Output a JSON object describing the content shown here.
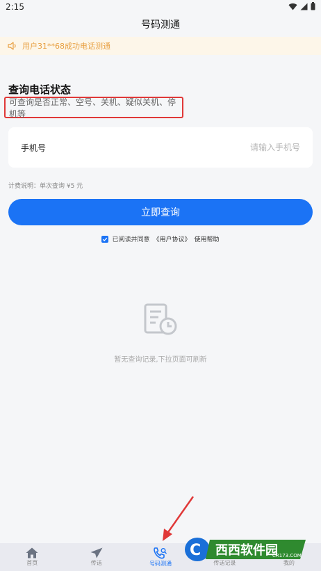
{
  "status_bar": {
    "time": "2:15"
  },
  "header": {
    "title": "号码测通"
  },
  "notice": {
    "text": "用户31**68成功电话测通"
  },
  "query": {
    "title": "查询电话状态",
    "subtitle": "可查询是否正常、空号、关机、疑似关机、停机等",
    "phone_label": "手机号",
    "phone_value": "",
    "phone_placeholder": "请输入手机号",
    "fee_note": "计费说明：单次查询 ¥5 元",
    "submit_label": "立即查询",
    "agree_text": "已阅读并同意",
    "agreement_link": "《用户协议》",
    "help_link": "使用帮助"
  },
  "empty_state": {
    "text": "暂无查询记录,下拉页面可刷新"
  },
  "tabs": [
    {
      "label": "首页",
      "icon": "home-icon",
      "active": false
    },
    {
      "label": "传话",
      "icon": "send-icon",
      "active": false
    },
    {
      "label": "号码测通",
      "icon": "phone-search-icon",
      "active": true
    },
    {
      "label": "传话记录",
      "icon": "records-icon",
      "active": false
    },
    {
      "label": "我的",
      "icon": "profile-icon",
      "active": false
    }
  ],
  "watermark": {
    "brand": "西西软件园",
    "url": "CR173.COM"
  },
  "colors": {
    "accent": "#1b73f5",
    "notice": "#e8a042",
    "highlight_border": "#e03838"
  }
}
